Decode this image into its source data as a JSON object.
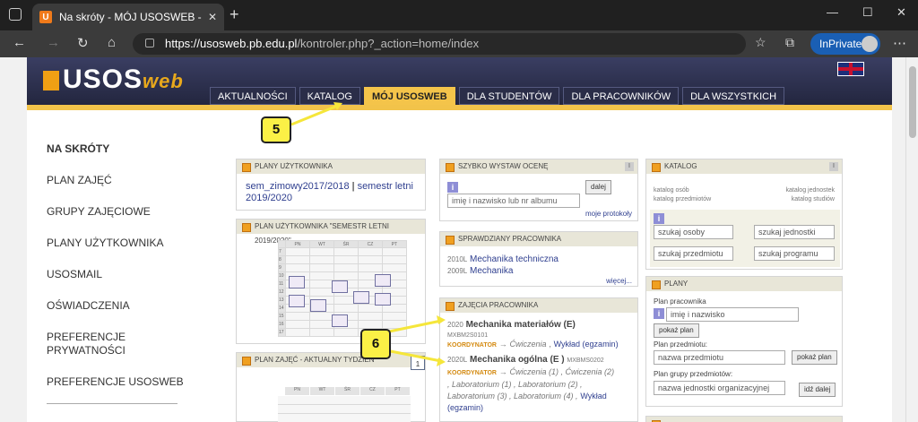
{
  "browser": {
    "tab_title": "Na skróty - MÓJ USOSWEB - US",
    "tab_favicon": "U",
    "url_host": "https://usosweb.pb.edu.pl",
    "url_path": "/kontroler.php?_action=home/index",
    "inprivate_label": "InPrivate"
  },
  "header": {
    "logo_main": "USOS",
    "logo_web": "web",
    "menu": [
      "AKTUALNOŚCI",
      "KATALOG",
      "MÓJ USOSWEB",
      "DLA STUDENTÓW",
      "DLA PRACOWNIKÓW",
      "DLA WSZYSTKICH"
    ],
    "active_menu": "MÓJ USOSWEB"
  },
  "sidebar": {
    "heading": "NA SKRÓTY",
    "items": [
      "PLAN ZAJĘĆ",
      "GRUPY ZAJĘCIOWE",
      "PLANY UŻYTKOWNIKA",
      "USOSMAIL",
      "OŚWIADCZENIA",
      "PREFERENCJE",
      "PRYWATNOŚCI",
      "PREFERENCJE USOSWEB"
    ]
  },
  "plany_uzytkownika": {
    "title": "PLANY UŻYTKOWNIKA",
    "link1": "sem_zimowy2017/2018",
    "sep": "|",
    "link2": "semestr letni",
    "link3": "2019/2020"
  },
  "plan_uzytkownika_sem": {
    "title": "PLAN UŻYTKOWNIKA \"semestr letni 2019/2020\"",
    "days": [
      "PN",
      "WT",
      "ŚR",
      "CZ",
      "PT"
    ],
    "hours": [
      "7",
      "8",
      "9",
      "10",
      "11",
      "12",
      "13",
      "14",
      "15",
      "16",
      "17"
    ]
  },
  "plan_zajec_tydzien": {
    "title": "PLAN ZAJĘĆ - AKTUALNY TYDZIEŃ",
    "days": [
      "PN",
      "WT",
      "ŚR",
      "CZ",
      "PT"
    ],
    "calendar_day": "1"
  },
  "szybko_ocena": {
    "title": "SZYBKO WYSTAW OCENĘ",
    "button": "dalej",
    "placeholder": "imię i nazwisko lub nr albumu",
    "link": "moje protokoły"
  },
  "sprawdziany": {
    "title": "SPRAWDZIANY PRACOWNIKA",
    "rows": [
      {
        "code": "2010L",
        "name": "Mechanika techniczna"
      },
      {
        "code": "2009L",
        "name": "Mechanika"
      }
    ],
    "more": "więcej..."
  },
  "zajecia": {
    "title": "ZAJĘCIA PRACOWNIKA",
    "course1_code_prefix": "2020",
    "course1_name": "Mechanika materiałów (E)",
    "course1_code": "MXBM2S0101",
    "coordinator": "KOORDYNATOR",
    "arrow": "→",
    "course1_classes": "Ćwiczenia",
    "course1_lecture": "Wykład (egzamin)",
    "course2_code_prefix": "2020L",
    "course2_name": "Mechanika ogólna (E )",
    "course2_code": "MXBMS0202",
    "course2_line1": "Ćwiczenia (1) , Ćwiczenia (2)",
    "course2_line2": ", Laboratorium (1) , Laboratorium (2) ,",
    "course2_line3": "Laboratorium (3) , Laboratorium (4) ,",
    "course2_lecture_a": "Wykład",
    "course2_lecture_b": "(egzamin)"
  },
  "katalog": {
    "title": "KATALOG",
    "l1": "katalog osób",
    "l2": "katalog przedmiotów",
    "r1": "katalog jednostek",
    "r2": "katalog studiów",
    "p1": "szukaj osoby",
    "p2": "szukaj jednostki",
    "p3": "szukaj przedmiotu",
    "p4": "szukaj programu"
  },
  "plany": {
    "title": "PLANY",
    "label1": "Plan pracownika",
    "input1": "imię i nazwisko",
    "btn1": "pokaż plan",
    "label2": "Plan przedmiotu:",
    "input2": "nazwa przedmiotu",
    "btn2": "pokaż plan",
    "label3": "Plan grupy przedmiotów:",
    "input3": "nazwa jednostki organizacyjnej",
    "btn3": "idź dalej"
  },
  "callouts": {
    "c5": "5",
    "c6": "6"
  },
  "colors": {
    "accent_gold": "#f2c34a",
    "header_dark": "#2a2d48",
    "callout_yellow": "#fbf046"
  }
}
